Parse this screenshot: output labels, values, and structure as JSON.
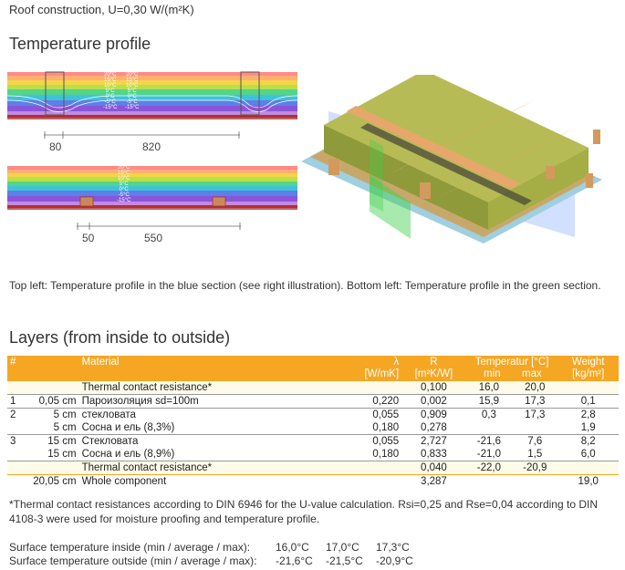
{
  "header": {
    "subtitle": "Roof construction, U=0,30 W/(m²K)"
  },
  "temperature_profile": {
    "title": "Temperature profile",
    "top_dims": [
      "80",
      "820"
    ],
    "bottom_dims": [
      "50",
      "550"
    ],
    "top_temp_labels": [
      "20°C",
      "15°C",
      "10°C",
      "5°C",
      "0°C",
      "-5°C",
      "-15°C"
    ],
    "bottom_temp_labels": [
      "20°C",
      "15°C",
      "10°C",
      "5°C",
      "0°C",
      "-5°C",
      "-15°C"
    ],
    "caption": "Top left: Temperature profile in the blue section (see right illustration). Bottom left: Temperature profile in the green section."
  },
  "layers": {
    "title": "Layers (from inside to outside)",
    "headers": {
      "num": "#",
      "material": "Material",
      "lambda": "λ",
      "lambda_unit": "[W/mK]",
      "r": "R",
      "r_unit": "[m²K/W]",
      "temp": "Temperatur [°C]",
      "temp_min": "min",
      "temp_max": "max",
      "weight": "Weight",
      "weight_unit": "[kg/m²]"
    },
    "rows": [
      {
        "num": "",
        "thick": "",
        "material": "Thermal contact resistance*",
        "lambda": "",
        "r": "0,100",
        "tmin": "16,0",
        "tmax": "20,0",
        "weight": ""
      },
      {
        "num": "1",
        "thick": "0,05 cm",
        "material": "Пароизоляция sd=100m",
        "lambda": "0,220",
        "r": "0,002",
        "tmin": "15,9",
        "tmax": "17,3",
        "weight": "0,1"
      },
      {
        "num": "2",
        "thick": "5 cm",
        "material": "стекловата",
        "lambda": "0,055",
        "r": "0,909",
        "tmin": "0,3",
        "tmax": "17,3",
        "weight": "2,8"
      },
      {
        "num": "",
        "thick": "5 cm",
        "material": "Сосна и ель (8,3%)",
        "lambda": "0,180",
        "r": "0,278",
        "tmin": "",
        "tmax": "",
        "weight": "1,9"
      },
      {
        "num": "3",
        "thick": "15 cm",
        "material": "Стекловата",
        "lambda": "0,055",
        "r": "2,727",
        "tmin": "-21,6",
        "tmax": "7,6",
        "weight": "8,2"
      },
      {
        "num": "",
        "thick": "15 cm",
        "material": "Сосна и ель (8,9%)",
        "lambda": "0,180",
        "r": "0,833",
        "tmin": "-21,0",
        "tmax": "1,5",
        "weight": "6,0"
      },
      {
        "num": "",
        "thick": "",
        "material": "Thermal contact resistance*",
        "lambda": "",
        "r": "0,040",
        "tmin": "-22,0",
        "tmax": "-20,9",
        "weight": ""
      }
    ],
    "total": {
      "thick": "20,05 cm",
      "material": "Whole component",
      "r": "3,287",
      "weight": "19,0"
    }
  },
  "footnote": "*Thermal contact resistances according to DIN 6946 for the U-value calculation. Rsi=0,25 and Rse=0,04 according to DIN 4108-3 were used for moisture proofing and temperature profile.",
  "surface": {
    "inside_label": "Surface temperature inside (min / average / max):",
    "inside_values": [
      "16,0°C",
      "17,0°C",
      "17,3°C"
    ],
    "outside_label": "Surface temperature outside (min / average / max):",
    "outside_values": [
      "-21,6°C",
      "-21,5°C",
      "-20,9°C"
    ]
  }
}
